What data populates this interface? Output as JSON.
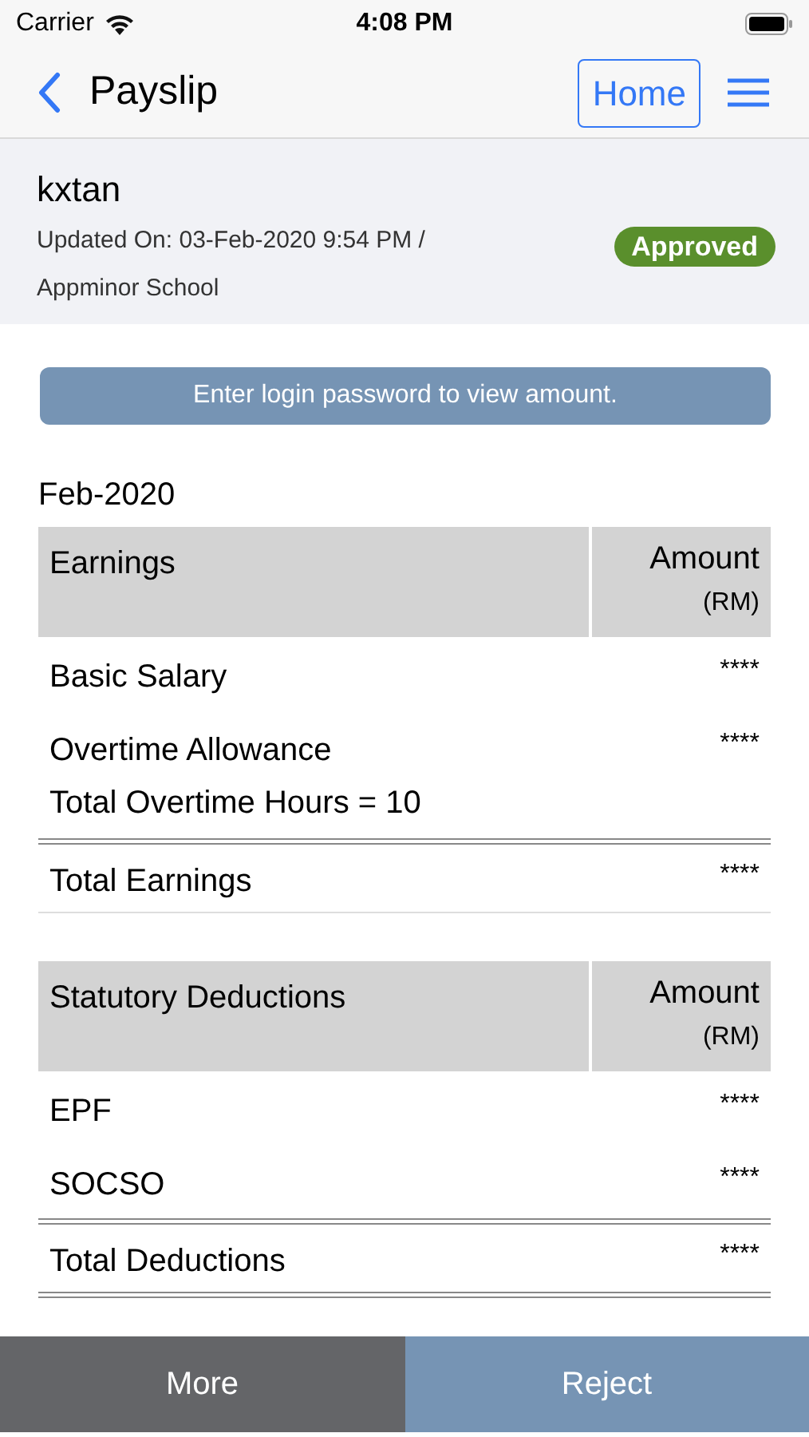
{
  "status_bar": {
    "carrier": "Carrier",
    "time": "4:08 PM"
  },
  "nav": {
    "title": "Payslip",
    "home_button": "Home"
  },
  "header": {
    "name": "kxtan",
    "updated": "Updated On: 03-Feb-2020 9:54 PM /",
    "school": "Appminor School",
    "status": "Approved"
  },
  "password_button": "Enter login password to view amount.",
  "period": "Feb-2020",
  "sections": [
    {
      "title": "Earnings",
      "amount_header": "Amount",
      "unit": "(RM)",
      "rows": [
        {
          "kind": "item",
          "label": "Basic Salary",
          "amount": "****"
        },
        {
          "kind": "item",
          "label": "Overtime Allowance",
          "amount": "****"
        },
        {
          "kind": "note",
          "label": "Total Overtime Hours = 10"
        },
        {
          "kind": "total",
          "label": "Total Earnings",
          "amount": "****"
        }
      ]
    },
    {
      "title": "Statutory Deductions",
      "amount_header": "Amount",
      "unit": "(RM)",
      "rows": [
        {
          "kind": "item",
          "label": "EPF",
          "amount": "****"
        },
        {
          "kind": "item",
          "label": "SOCSO",
          "amount": "****"
        },
        {
          "kind": "total",
          "label": "Total Deductions",
          "amount": "****"
        }
      ]
    }
  ],
  "bottom_buttons": [
    {
      "label": "More",
      "kind": "secondary"
    },
    {
      "label": "Reject",
      "kind": "primary"
    }
  ]
}
